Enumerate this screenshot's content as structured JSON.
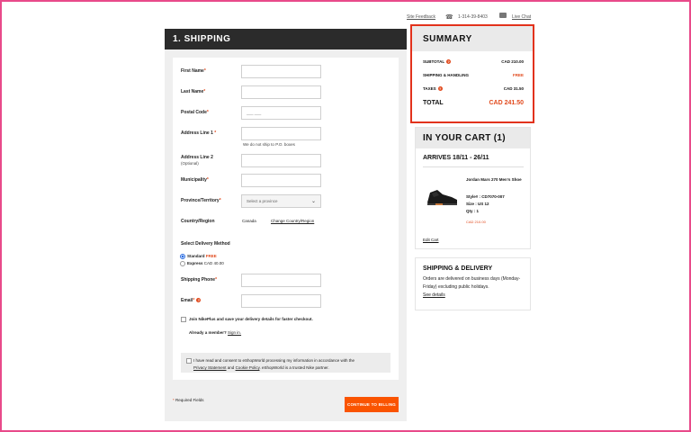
{
  "utility": {
    "feedback": "Site Feedback",
    "phone": "1-314-39-8403",
    "chat": "Live Chat"
  },
  "shipping": {
    "title": "1. SHIPPING",
    "fields": {
      "first_name": "First Name",
      "last_name": "Last Name",
      "postal_code": "Postal Code",
      "postal_placeholder": "___ ___",
      "address1": "Address Line 1",
      "address1_note": "We do not ship to P.O. boxes",
      "address2": "Address Line 2",
      "address2_optional": "(Optional)",
      "municipality": "Municipality",
      "province": "Province/Territory",
      "province_placeholder": "Select a province",
      "country_label": "Country/Region",
      "country_value": "Canada",
      "change_country": "Change Country/Region"
    },
    "delivery": {
      "heading": "Select Delivery Method",
      "standard_label": "Standard",
      "standard_price": "FREE",
      "express_label": "Express",
      "express_price": "CAD 40.00"
    },
    "phone_label": "Shipping Phone",
    "email_label": "Email",
    "join_text": "Join NikePlus and save your delivery details for faster checkout.",
    "already_member": "Already a member?",
    "sign_in": "Sign in.",
    "consent": {
      "line1": "I have read and consent to eShopWorld processing my information in accordance with the",
      "privacy": "Privacy Statement",
      "and": "and",
      "cookie": "Cookie Policy",
      "rest": ". eShopWorld is a trusted Nike partner."
    },
    "required_note": "Required Fields",
    "continue": "CONTINUE TO BILLING"
  },
  "summary": {
    "title": "SUMMARY",
    "subtotal_label": "SUBTOTAL",
    "subtotal_value": "CAD 210.00",
    "shipping_label": "SHIPPING & HANDLING",
    "shipping_value": "FREE",
    "taxes_label": "TAXES",
    "taxes_value": "CAD 31.50",
    "total_label": "TOTAL",
    "total_value": "CAD 241.50"
  },
  "cart": {
    "title": "IN YOUR CART (1)",
    "arrives": "ARRIVES 18/11 - 26/11",
    "product_name": "Jordan Mars 270 Men's Shoe",
    "style": "Style# : CD7070-007",
    "size": "Size : US 12",
    "qty": "Qty : 1",
    "price": "CAD 210.00",
    "edit": "Edit Cart"
  },
  "delivery_info": {
    "title": "SHIPPING & DELIVERY",
    "text": "Orders are delivered on business days (Monday-Friday) excluding public holidays.",
    "link": "See details"
  },
  "colors": {
    "accent": "#fa5400",
    "highlight_border": "#e2321c",
    "header_dark": "#2b2b2b"
  }
}
